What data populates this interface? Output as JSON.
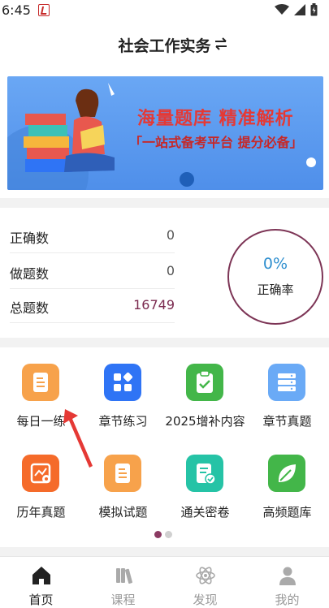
{
  "status_bar": {
    "time": "6:45"
  },
  "header": {
    "title": "社会工作实务"
  },
  "banner": {
    "headline": "海量题库 精准解析",
    "subline": "「一站式备考平台 提分必备」"
  },
  "stats": {
    "rows": [
      {
        "label": "正确数",
        "value": "0"
      },
      {
        "label": "做题数",
        "value": "0"
      },
      {
        "label": "总题数",
        "value": "16749"
      }
    ],
    "accuracy": {
      "percent": "0%",
      "label": "正确率"
    }
  },
  "grid": {
    "items": [
      {
        "label": "每日一练",
        "icon": "document-icon",
        "color": "#f7a24b"
      },
      {
        "label": "章节练习",
        "icon": "apps-icon",
        "color": "#2f74f5"
      },
      {
        "label": "2025增补内容",
        "icon": "clipboard-check-icon",
        "color": "#43b649"
      },
      {
        "label": "章节真题",
        "icon": "server-icon",
        "color": "#6aaaf6"
      },
      {
        "label": "历年真题",
        "icon": "chart-image-icon",
        "color": "#f56b2a"
      },
      {
        "label": "模拟试题",
        "icon": "document-icon",
        "color": "#f7a24b"
      },
      {
        "label": "通关密卷",
        "icon": "exam-paper-icon",
        "color": "#25c3a6"
      },
      {
        "label": "高频题库",
        "icon": "leaf-icon",
        "color": "#43b649"
      }
    ],
    "page_count": 2,
    "active_page": 1
  },
  "tabbar": {
    "items": [
      {
        "label": "首页",
        "icon": "home-icon",
        "active": true
      },
      {
        "label": "课程",
        "icon": "books-icon",
        "active": false
      },
      {
        "label": "发现",
        "icon": "atom-icon",
        "active": false
      },
      {
        "label": "我的",
        "icon": "user-icon",
        "active": false
      }
    ]
  },
  "colors": {
    "accent": "#8b3a62",
    "percent": "#2f8fcf",
    "headline": "#e53935"
  }
}
